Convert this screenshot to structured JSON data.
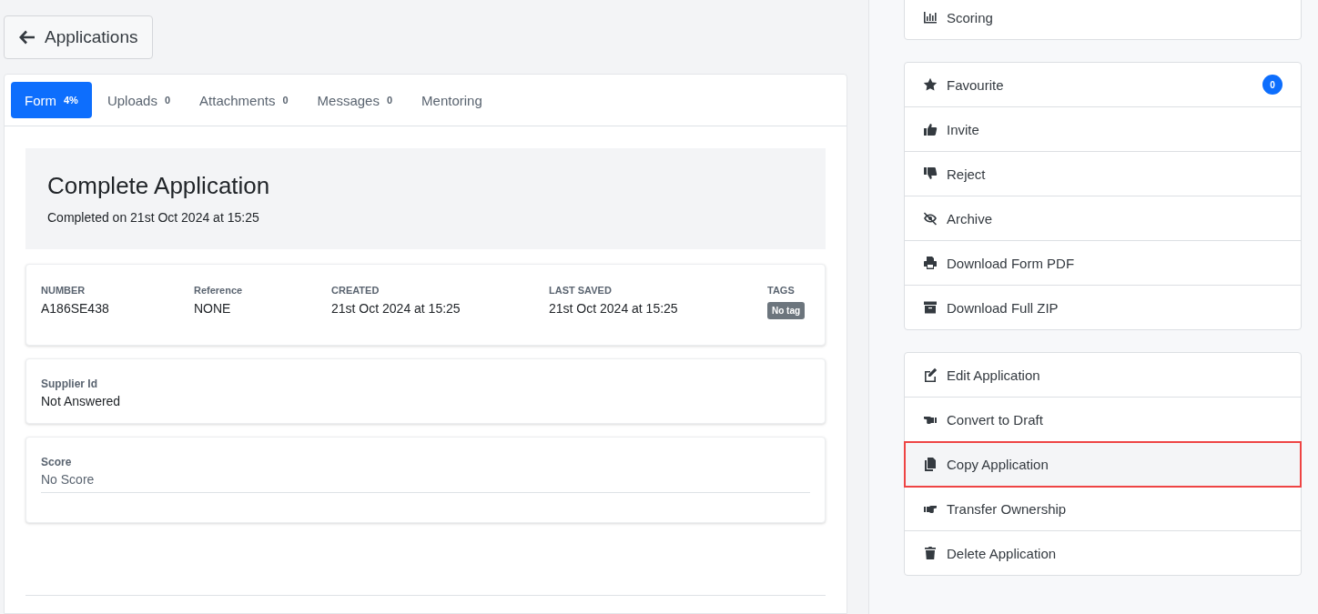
{
  "back_button": {
    "label": "Applications"
  },
  "tabs": [
    {
      "label": "Form",
      "count": "4%",
      "selected": true
    },
    {
      "label": "Uploads",
      "count": "0",
      "selected": false
    },
    {
      "label": "Attachments",
      "count": "0",
      "selected": false
    },
    {
      "label": "Messages",
      "count": "0",
      "selected": false
    },
    {
      "label": "Mentoring",
      "selected": false
    }
  ],
  "status_panel": {
    "title": "Complete Application",
    "subtitle": "Completed on 21st Oct 2024 at 15:25"
  },
  "meta": [
    {
      "label": "NUMBER",
      "value": "A186SE438"
    },
    {
      "label": "Reference",
      "value": "NONE"
    },
    {
      "label": "CREATED",
      "value": "21st Oct 2024 at 15:25"
    },
    {
      "label": "LAST SAVED",
      "value": "21st Oct 2024 at 15:25"
    },
    {
      "label": "TAGS",
      "tag": "No tag"
    }
  ],
  "fields": [
    {
      "label": "Supplier Id",
      "value": "Not Answered",
      "kind": "plain"
    },
    {
      "label": "Score",
      "value": "No Score",
      "kind": "score"
    }
  ],
  "action_groups": [
    [
      {
        "kind": "chart",
        "label": "Scoring",
        "highlighted": false
      }
    ],
    [
      {
        "kind": "star",
        "label": "Favourite",
        "badge": "0",
        "highlighted": false
      },
      {
        "kind": "thumbs-up",
        "label": "Invite",
        "highlighted": false
      },
      {
        "kind": "thumbs-down",
        "label": "Reject",
        "highlighted": false
      },
      {
        "kind": "eye-slash",
        "label": "Archive",
        "highlighted": false
      },
      {
        "kind": "printer",
        "label": "Download Form PDF",
        "highlighted": false
      },
      {
        "kind": "archive",
        "label": "Download Full ZIP",
        "highlighted": false
      }
    ],
    [
      {
        "kind": "edit",
        "label": "Edit Application",
        "highlighted": false
      },
      {
        "kind": "hand-left",
        "label": "Convert to Draft",
        "highlighted": false
      },
      {
        "kind": "copy",
        "label": "Copy Application",
        "highlighted": true
      },
      {
        "kind": "hand-right",
        "label": "Transfer Ownership",
        "highlighted": false
      },
      {
        "kind": "trash",
        "label": "Delete Application",
        "highlighted": false
      }
    ]
  ]
}
